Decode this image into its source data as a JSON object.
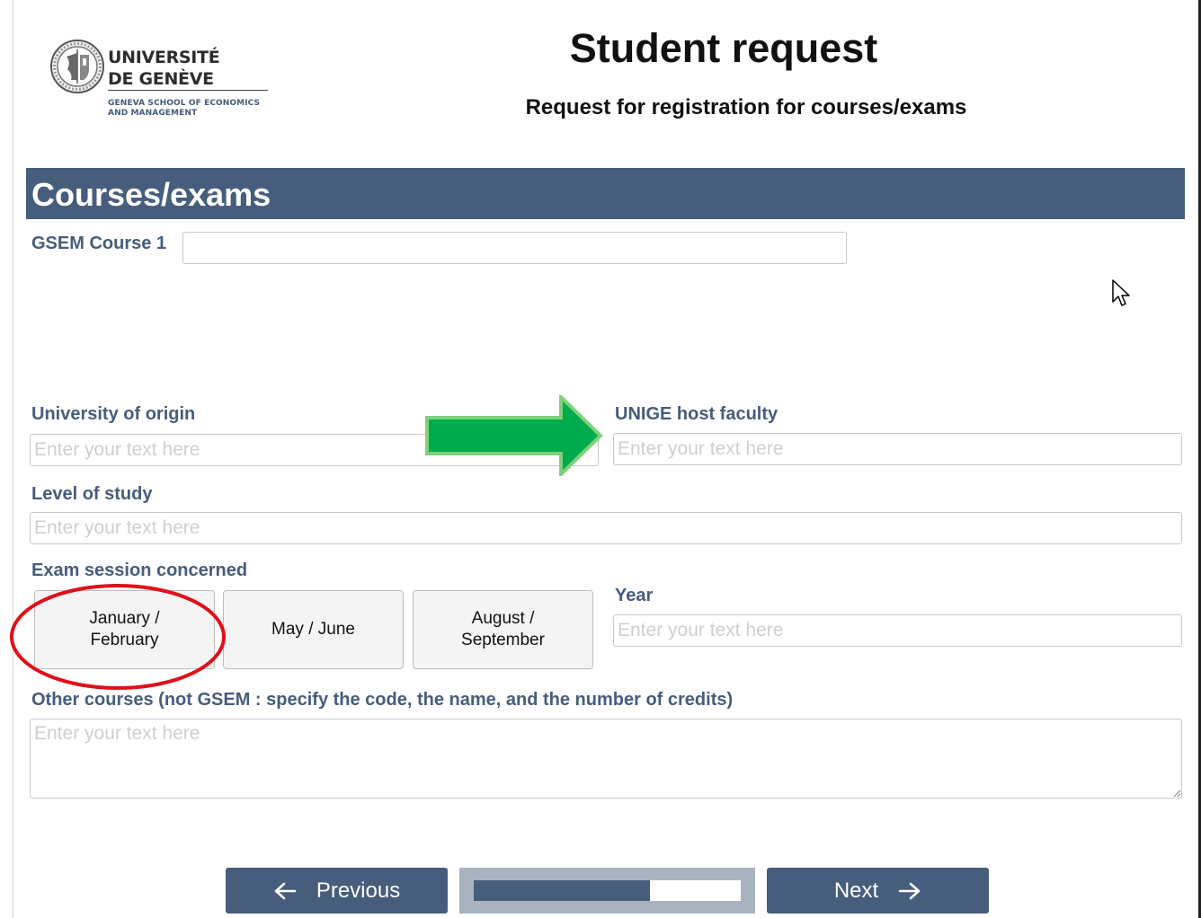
{
  "logo": {
    "line1": "UNIVERSITÉ",
    "line2": "DE GENÈVE",
    "sub1": "GENEVA SCHOOL OF ECONOMICS",
    "sub2": "AND MANAGEMENT"
  },
  "header": {
    "title": "Student request",
    "subtitle": "Request for registration for courses/exams"
  },
  "section": {
    "title": "Courses/exams"
  },
  "form": {
    "gsem_course1": {
      "label": "GSEM Course 1",
      "value": ""
    },
    "university_origin": {
      "label": "University of origin",
      "value": "",
      "placeholder": "Enter your text here"
    },
    "host_faculty": {
      "label": "UNIGE host faculty",
      "value": "",
      "placeholder": "Enter your text here"
    },
    "level_of_study": {
      "label": "Level of study",
      "value": "",
      "placeholder": "Enter your text here"
    },
    "exam_session": {
      "label": "Exam session concerned",
      "options": [
        "January / February",
        "May / June",
        "August / September"
      ]
    },
    "year": {
      "label": "Year",
      "value": "",
      "placeholder": "Enter your text here"
    },
    "other_courses": {
      "label": "Other courses (not GSEM : specify the code, the name, and the number of credits)",
      "value": "",
      "placeholder": "Enter your text here"
    }
  },
  "nav": {
    "previous_label": "Previous",
    "next_label": "Next",
    "progress_fraction": 0.66
  },
  "colors": {
    "accent": "#465d7c",
    "annotation_arrow": "#00ab4e",
    "annotation_circle": "#e0101a"
  },
  "icons": {
    "logo": "university-seal-icon",
    "previous": "arrow-left-icon",
    "next": "arrow-right-icon",
    "cursor": "mouse-pointer-icon"
  }
}
